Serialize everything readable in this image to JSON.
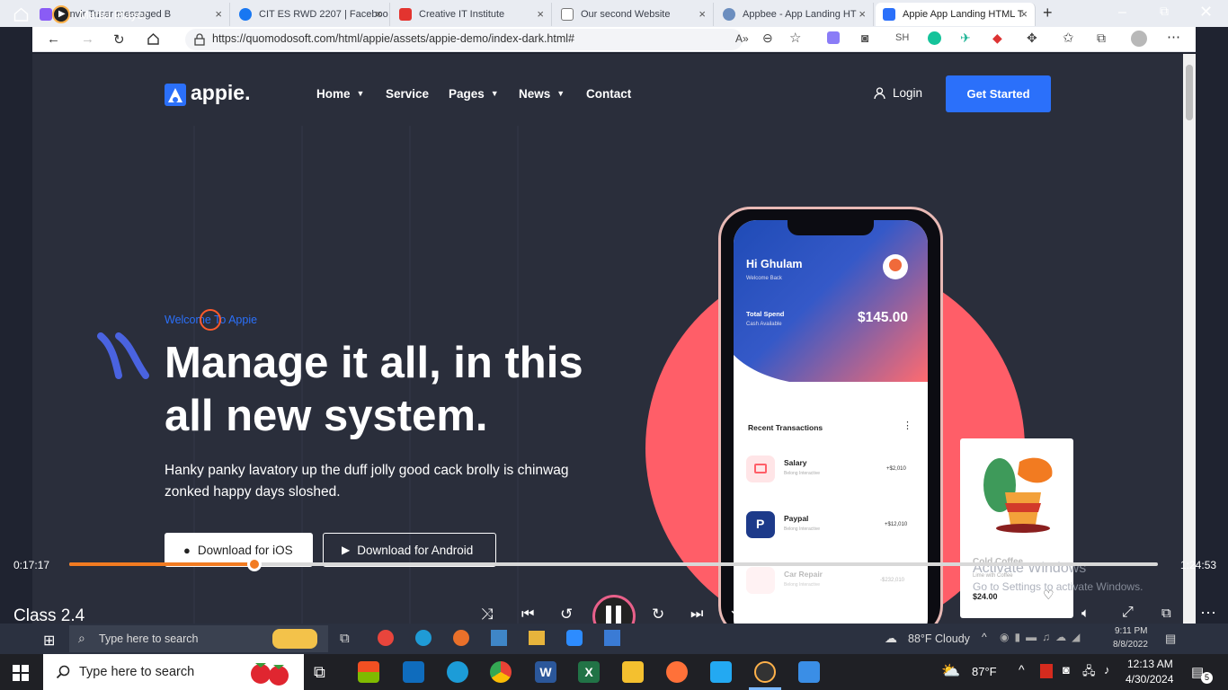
{
  "media_player": {
    "app_title": "Media Player",
    "current_time": "0:17:17",
    "total_time": "1:24:53",
    "progress_fraction": 0.17,
    "video_title": "Class 2.4"
  },
  "browser": {
    "tabs": [
      {
        "label": "Tanvir Tusar messaged B"
      },
      {
        "label": "CIT ES RWD 2207 | Faceboo"
      },
      {
        "label": "Creative IT Institute"
      },
      {
        "label": "Our second Website"
      },
      {
        "label": "Appbee - App Landing HT"
      },
      {
        "label": "Appie App Landing HTML T"
      }
    ],
    "url": "https://quomodosoft.com/html/appie/assets/appie-demo/index-dark.html#",
    "profile_initials": "SH"
  },
  "site": {
    "logo_text": "appie.",
    "nav": [
      {
        "label": "Home",
        "dropdown": true
      },
      {
        "label": "Service",
        "dropdown": false
      },
      {
        "label": "Pages",
        "dropdown": true
      },
      {
        "label": "News",
        "dropdown": true
      },
      {
        "label": "Contact",
        "dropdown": false
      }
    ],
    "login_label": "Login",
    "cta_label": "Get Started",
    "hero_kicker": "Welcome To Appie",
    "hero_title": "Manage it all, in this all new system.",
    "hero_desc": "Hanky panky lavatory up the duff jolly good cack brolly is chinwag zonked happy days sloshed.",
    "download_ios": "Download for iOS",
    "download_android": "Download for Android",
    "phone": {
      "greeting": "Hi Ghulam",
      "welcome": "Welcome Back",
      "total_spend_label": "Total Spend",
      "cash_label": "Cash Available",
      "amount": "$145.00",
      "recent_label": "Recent Transactions",
      "transactions": [
        {
          "name": "Salary",
          "sub": "Belong Interactive",
          "amount": "+$2,010"
        },
        {
          "name": "Paypal",
          "sub": "Belong Interactive",
          "amount": "+$12,010"
        },
        {
          "name": "Car Repair",
          "sub": "Belong Interactive",
          "amount": "-$232,010"
        }
      ]
    },
    "coffee_card": {
      "title": "Cold Coffee",
      "subtitle": "Lime with Coffee",
      "price": "$24.00"
    }
  },
  "watermark": {
    "line1": "Activate Windows",
    "line2": "Go to Settings to activate Windows."
  },
  "inner_taskbar": {
    "search_placeholder": "Type here to search",
    "weather": "88°F Cloudy",
    "time": "9:11 PM",
    "date": "8/8/2022"
  },
  "taskbar": {
    "search_placeholder": "Type here to search",
    "temperature": "87°F",
    "time": "12:13 AM",
    "date": "4/30/2024",
    "notification_count": "5"
  },
  "colors": {
    "accent": "#2b70fa",
    "coral": "#ff5e68",
    "progress": "#f27b21"
  }
}
